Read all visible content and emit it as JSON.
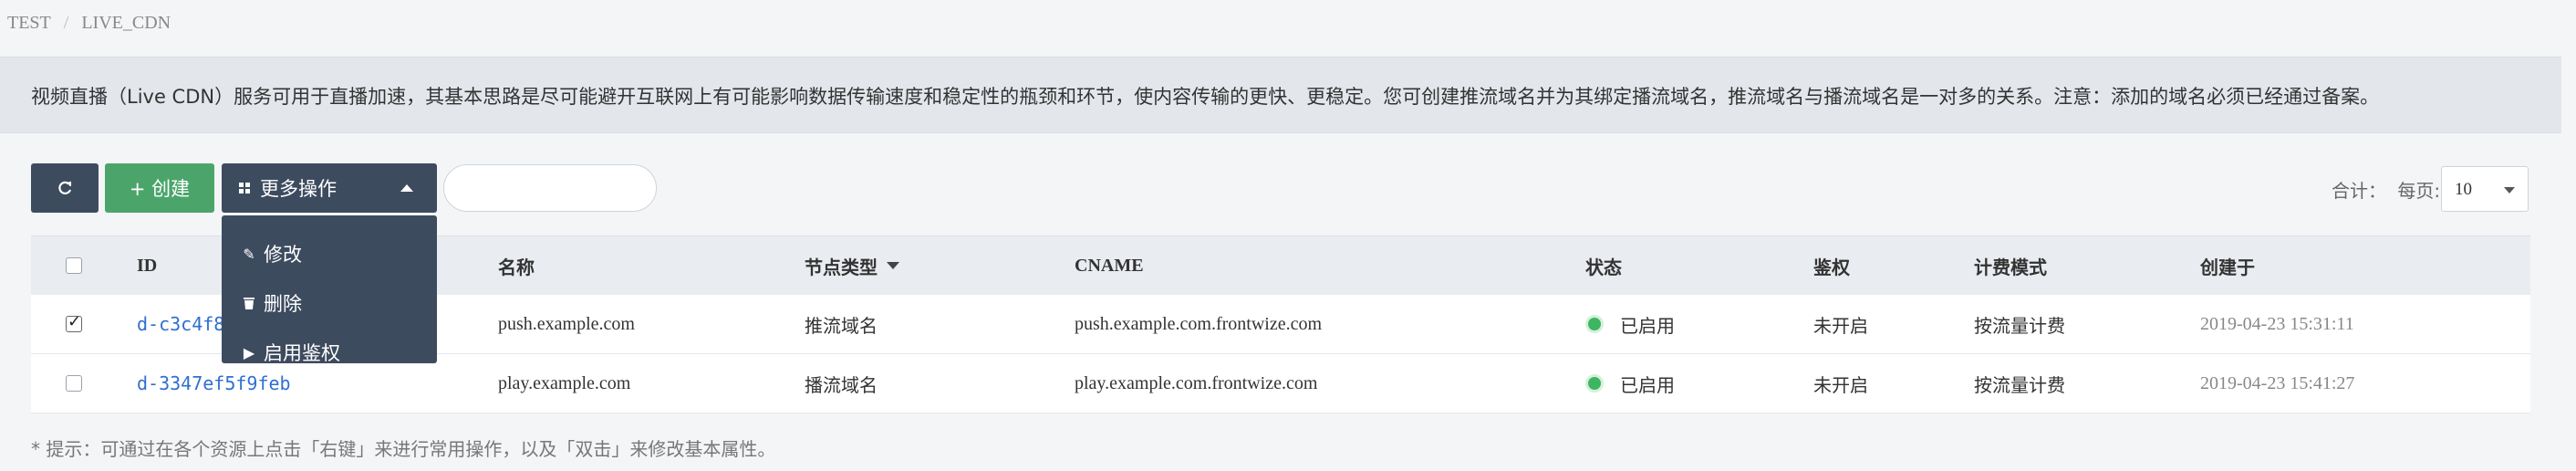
{
  "breadcrumb": [
    "TEST",
    "LIVE_CDN"
  ],
  "notice": "视频直播（Live CDN）服务可用于直播加速，其基本思路是尽可能避开互联网上有可能影响数据传输速度和稳定性的瓶颈和环节，使内容传输的更快、更稳定。您可创建推流域名并为其绑定播流域名，推流域名与播流域名是一对多的关系。注意：添加的域名必须已经通过备案。",
  "toolbar": {
    "create_label": "+ 创建",
    "more_label": "更多操作",
    "search_placeholder": ""
  },
  "dropdown": {
    "items": [
      "修改",
      "删除",
      "启用鉴权"
    ]
  },
  "pager": {
    "total_label": "合计：",
    "per_page_label": "每页:",
    "per_page_value": "10"
  },
  "table": {
    "headers": {
      "id": "ID",
      "name": "名称",
      "node_type": "节点类型",
      "cname": "CNAME",
      "status": "状态",
      "auth": "鉴权",
      "billing": "计费模式",
      "created": "创建于"
    },
    "rows": [
      {
        "checked": true,
        "id": "d-c3c4f8",
        "name": "push.example.com",
        "node_type": "推流域名",
        "cname": "push.example.com.frontwize.com",
        "status": "已启用",
        "auth": "未开启",
        "billing": "按流量计费",
        "created": "2019-04-23 15:31:11"
      },
      {
        "checked": false,
        "id": "d-3347ef5f9feb",
        "name": "play.example.com",
        "node_type": "播流域名",
        "cname": "play.example.com.frontwize.com",
        "status": "已启用",
        "auth": "未开启",
        "billing": "按流量计费",
        "created": "2019-04-23 15:41:27"
      }
    ]
  },
  "tip": "* 提示：可通过在各个资源上点击「右键」来进行常用操作，以及「双击」来修改基本属性。",
  "colors": {
    "primary_dark": "#3d4b5f",
    "create_green": "#4ba56b",
    "link_blue": "#2f6fd1",
    "status_green": "#3eb561"
  },
  "icons": {
    "refresh": "refresh-icon",
    "more": "grid-icon",
    "caret_up": "caret-up-icon",
    "edit": "pencil-icon",
    "delete": "trash-icon",
    "enable_auth": "play-icon",
    "sort": "caret-down-icon"
  }
}
